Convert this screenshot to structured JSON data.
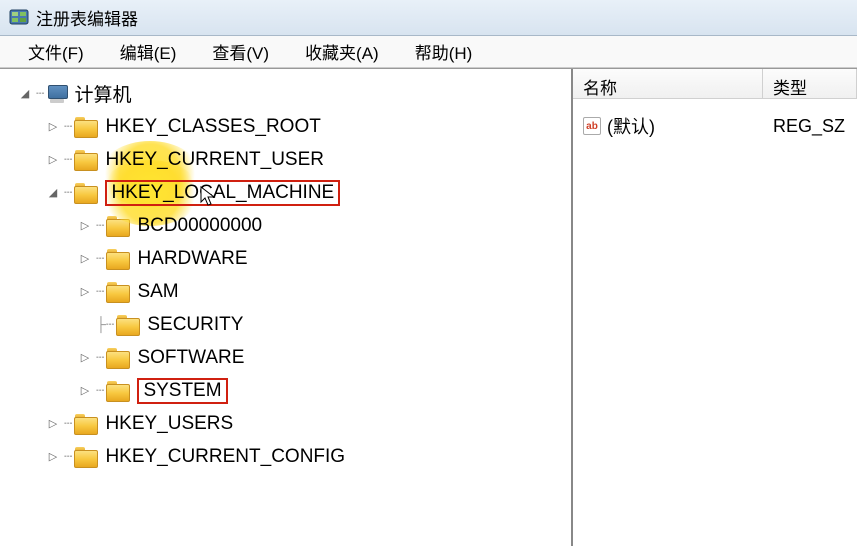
{
  "window": {
    "title": "注册表编辑器"
  },
  "menu": {
    "file": "文件(F)",
    "edit": "编辑(E)",
    "view": "查看(V)",
    "favorites": "收藏夹(A)",
    "help": "帮助(H)"
  },
  "tree": {
    "root": "计算机",
    "hkcr": "HKEY_CLASSES_ROOT",
    "hkcu": "HKEY_CURRENT_USER",
    "hklm": "HKEY_LOCAL_MACHINE",
    "hklm_children": {
      "bcd": "BCD00000000",
      "hardware": "HARDWARE",
      "sam": "SAM",
      "security": "SECURITY",
      "software": "SOFTWARE",
      "system": "SYSTEM"
    },
    "hku": "HKEY_USERS",
    "hkcc": "HKEY_CURRENT_CONFIG"
  },
  "list": {
    "header_name": "名称",
    "header_type": "类型",
    "rows": [
      {
        "name": "(默认)",
        "type": "REG_SZ"
      }
    ]
  },
  "icons": {
    "string_badge": "ab"
  }
}
